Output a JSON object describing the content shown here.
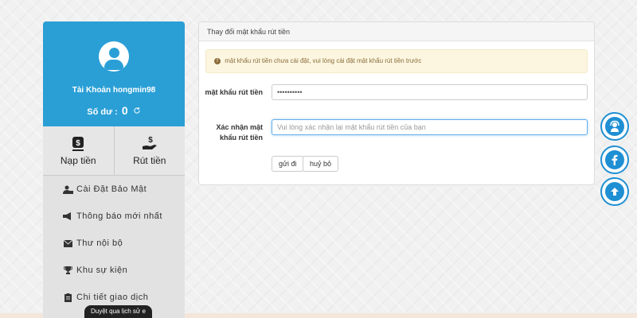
{
  "profile": {
    "account_label": "Tài Khoản",
    "username": "hongmin98",
    "balance_label": "Số dư :",
    "balance_value": "0",
    "refresh_icon": "refresh-icon"
  },
  "money_actions": {
    "deposit_label": "Nạp tiền",
    "withdraw_label": "Rút tiền"
  },
  "menu": {
    "items": [
      {
        "label": "Cài Đặt Bảo Mật",
        "icon": "user-lock-icon"
      },
      {
        "label": "Thông báo mới nhất",
        "icon": "bullhorn-icon"
      },
      {
        "label": "Thư nội bộ",
        "icon": "envelope-icon"
      },
      {
        "label": "Khu sự kiện",
        "icon": "trophy-icon"
      },
      {
        "label": "Chi tiết giao dịch",
        "icon": "clipboard-icon"
      }
    ]
  },
  "tooltip": "Duyệt qua lịch sử e",
  "panel": {
    "title": "Thay đổi mật khẩu rút tiền",
    "alert": "mật khẩu rút tiền chưa cài đặt, vui lòng cài đặt mật khẩu rút tiền trước",
    "password_label": "mật khẩu rút tiền",
    "password_value": "••••••••••",
    "confirm_label": "Xác nhận mật khẩu rút tiền",
    "confirm_placeholder": "Vui lòng xác nhận lại mật khẩu rút tiền của bạn",
    "submit_label": "gửi đi",
    "cancel_label": "huỷ bỏ"
  },
  "colors": {
    "primary": "#2a9fd6",
    "float_accent": "#1f8fd3",
    "sidebar_bg": "#e2e2e2",
    "alert_bg": "#fcf6e0"
  },
  "floating_buttons": [
    "support-agent-icon",
    "facebook-icon",
    "arrow-up-icon"
  ]
}
